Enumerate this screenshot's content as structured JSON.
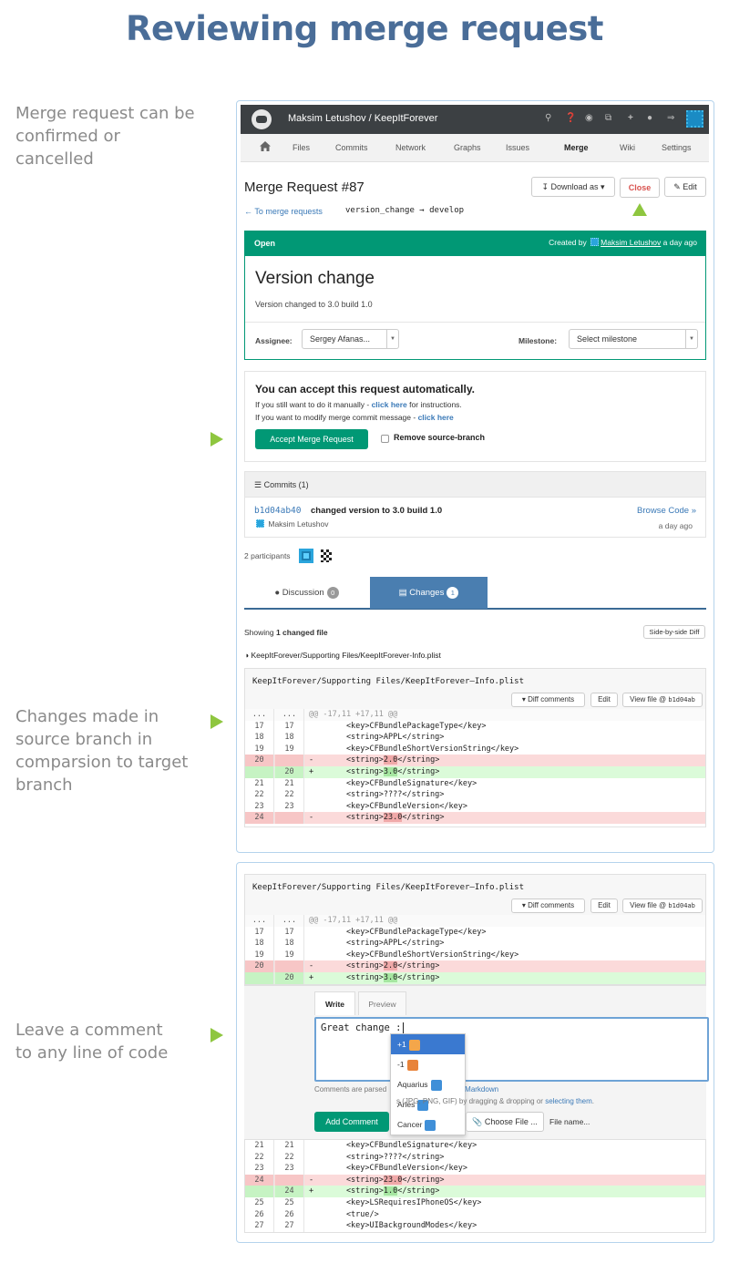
{
  "heading": "Reviewing merge request",
  "notes": {
    "confirm": [
      "Merge request can be",
      "confirmed or",
      "cancelled"
    ],
    "changes": [
      "Changes made in",
      "source branch in",
      "comparsion to target",
      "branch"
    ],
    "comment": [
      "Leave a comment",
      "to any line of code"
    ]
  },
  "colors": {
    "accent_green": "#8ec63f",
    "brand_green": "#019875",
    "link_blue": "#3a79b7",
    "tab_blue": "#4a7eb0"
  },
  "navbar": {
    "title": "Maksim Letushov / KeepItForever",
    "icons": [
      "search-icon",
      "help-icon",
      "globe-icon",
      "copy-icon",
      "plus-icon",
      "user-icon",
      "logout-icon"
    ]
  },
  "nav_tabs": [
    "Files",
    "Commits",
    "Network",
    "Graphs",
    "Issues",
    "Merge",
    "Wiki",
    "Settings"
  ],
  "mr": {
    "title": "Merge Request #87",
    "download_label": "Download as",
    "close_label": "Close",
    "edit_label": "Edit",
    "back_link": "← To merge requests",
    "branches": "version_change → develop",
    "status": "Open",
    "created_by_prefix": "Created by",
    "author": "Maksim Letushov",
    "created_ago": "a day ago",
    "heading": "Version change",
    "description": "Version changed to 3.0 build 1.0",
    "assignee_label": "Assignee:",
    "assignee_value": "Sergey Afanas...",
    "milestone_label": "Milestone:",
    "milestone_value": "Select milestone"
  },
  "accept": {
    "title": "You can accept this request automatically.",
    "line1_prefix": "If you still want to do it manually - ",
    "line1_link": "click here",
    "line1_suffix": " for instructions.",
    "line2_prefix": "If you want to modify merge commit message - ",
    "line2_link": "click here",
    "button": "Accept Merge Request",
    "remove_branch": "Remove source-branch"
  },
  "commits": {
    "header": "Commits (1)",
    "sha": "b1d04ab40",
    "message": "changed version to 3.0 build 1.0",
    "author": "Maksim Letushov",
    "browse": "Browse Code »",
    "time": "a day ago"
  },
  "participants": "2 participants",
  "tabs": {
    "discussion": "Discussion",
    "discussion_count": "0",
    "changes": "Changes",
    "changes_count": "1"
  },
  "showing_prefix": "Showing ",
  "showing_bold": "1 changed file",
  "side_by_side": "Side-by-side Diff",
  "file_path": "KeepItForever/Supporting Files/KeepItForever-Info.plist",
  "diff_header": {
    "path": "KeepItForever/Supporting Files/KeepItForever—Info.plist",
    "diff_comments": "Diff comments",
    "edit": "Edit",
    "view_file": "View file @",
    "view_sha": "b1d04ab"
  },
  "diff1": [
    {
      "t": "meta",
      "a": "...",
      "b": "...",
      "code": "@@ -17,11 +17,11 @@"
    },
    {
      "t": "ctx",
      "a": "17",
      "b": "17",
      "code": "        <key>CFBundlePackageType</key>"
    },
    {
      "t": "ctx",
      "a": "18",
      "b": "18",
      "code": "        <string>APPL</string>"
    },
    {
      "t": "ctx",
      "a": "19",
      "b": "19",
      "code": "        <key>CFBundleShortVersionString</key>"
    },
    {
      "t": "del",
      "a": "20",
      "b": "",
      "code": "-       <string>",
      "hl": "2.0",
      "tail": "</string>"
    },
    {
      "t": "add",
      "a": "",
      "b": "20",
      "code": "+       <string>",
      "hl": "3.0",
      "tail": "</string>"
    },
    {
      "t": "ctx",
      "a": "21",
      "b": "21",
      "code": "        <key>CFBundleSignature</key>"
    },
    {
      "t": "ctx",
      "a": "22",
      "b": "22",
      "code": "        <string>????</string>"
    },
    {
      "t": "ctx",
      "a": "23",
      "b": "23",
      "code": "        <key>CFBundleVersion</key>"
    },
    {
      "t": "del",
      "a": "24",
      "b": "",
      "code": "-       <string>",
      "hl": "23.0",
      "tail": "</string>"
    }
  ],
  "diff2_top": [
    {
      "t": "meta",
      "a": "...",
      "b": "...",
      "code": "@@ -17,11 +17,11 @@"
    },
    {
      "t": "ctx",
      "a": "17",
      "b": "17",
      "code": "        <key>CFBundlePackageType</key>"
    },
    {
      "t": "ctx",
      "a": "18",
      "b": "18",
      "code": "        <string>APPL</string>"
    },
    {
      "t": "ctx",
      "a": "19",
      "b": "19",
      "code": "        <key>CFBundleShortVersionString</key>"
    },
    {
      "t": "del",
      "a": "20",
      "b": "",
      "code": "-       <string>",
      "hl": "2.0",
      "tail": "</string>"
    },
    {
      "t": "add",
      "a": "",
      "b": "20",
      "code": "+       <string>",
      "hl": "3.0",
      "tail": "</string>"
    }
  ],
  "diff2_bottom": [
    {
      "t": "ctx",
      "a": "21",
      "b": "21",
      "code": "        <key>CFBundleSignature</key>"
    },
    {
      "t": "ctx",
      "a": "22",
      "b": "22",
      "code": "        <string>????</string>"
    },
    {
      "t": "ctx",
      "a": "23",
      "b": "23",
      "code": "        <key>CFBundleVersion</key>"
    },
    {
      "t": "del",
      "a": "24",
      "b": "",
      "code": "-       <string>",
      "hl": "23.0",
      "tail": "</string>"
    },
    {
      "t": "add",
      "a": "",
      "b": "24",
      "code": "+       <string>",
      "hl": "1.0",
      "tail": "</string>"
    },
    {
      "t": "ctx",
      "a": "25",
      "b": "25",
      "code": "        <key>LSRequiresIPhoneOS</key>"
    },
    {
      "t": "ctx",
      "a": "26",
      "b": "26",
      "code": "        <true/>"
    },
    {
      "t": "ctx",
      "a": "27",
      "b": "27",
      "code": "        <key>UIBackgroundModes</key>"
    }
  ],
  "comment": {
    "write_tab": "Write",
    "preview_tab": "Preview",
    "text": "Great change :",
    "hint_start": "Comments are parsed",
    "hint_mid": "Markdown",
    "hint_end": "s (JPG, PNG, GIF) by dragging & dropping or ",
    "hint_link": "selecting them",
    "add_button": "Add Comment",
    "choose_file": "Choose File ...",
    "file_name": "File name..."
  },
  "emoji_dropdown": [
    {
      "label": "+1",
      "icon": "thumbs-up-icon",
      "selected": true
    },
    {
      "label": "-1",
      "icon": "thumbs-down-icon",
      "selected": false
    },
    {
      "label": "Aquarius",
      "icon": "aquarius-icon",
      "selected": false
    },
    {
      "label": "Aries",
      "icon": "aries-icon",
      "selected": false
    },
    {
      "label": "Cancer",
      "icon": "cancer-icon",
      "selected": false
    }
  ]
}
